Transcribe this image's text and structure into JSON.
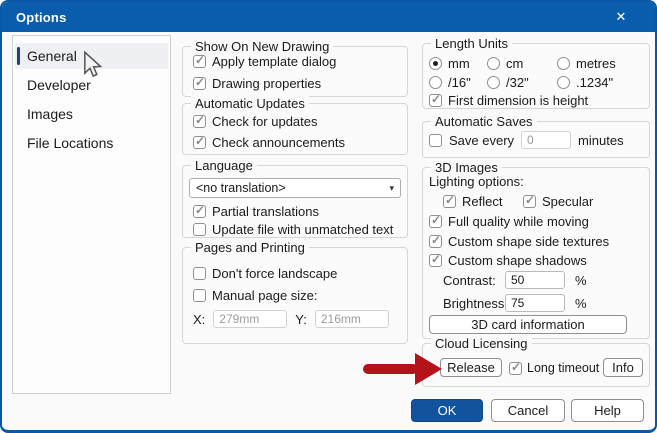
{
  "window": {
    "title": "Options",
    "close_icon": "✕"
  },
  "colors": {
    "titlebar": "#0a5dad",
    "ok_button": "#11549d",
    "annotation_arrow": "#b5121b",
    "sidebar_accent": "#17477f"
  },
  "sidebar": {
    "items": [
      {
        "label": "General",
        "selected": true
      },
      {
        "label": "Developer",
        "selected": false
      },
      {
        "label": "Images",
        "selected": false
      },
      {
        "label": "File Locations",
        "selected": false
      }
    ]
  },
  "mid": {
    "show": {
      "title": "Show On New Drawing",
      "items": [
        {
          "label": "Apply template dialog",
          "checked": true
        },
        {
          "label": "Drawing properties",
          "checked": true
        }
      ]
    },
    "updates": {
      "title": "Automatic Updates",
      "items": [
        {
          "label": "Check for updates",
          "checked": true
        },
        {
          "label": "Check announcements",
          "checked": true
        }
      ]
    },
    "language": {
      "title": "Language",
      "combo_value": "<no translation>",
      "combo_arrow": "▾",
      "items": [
        {
          "label": "Partial translations",
          "checked": true
        },
        {
          "label": "Update file with unmatched text",
          "checked": false
        }
      ]
    },
    "pages": {
      "title": "Pages and Printing",
      "items": [
        {
          "label": "Don't force landscape",
          "checked": false
        },
        {
          "label": "Manual page size:",
          "checked": false
        }
      ],
      "x_label": "X:",
      "x_value": "279mm",
      "y_label": "Y:",
      "y_value": "216mm"
    }
  },
  "right": {
    "length": {
      "title": "Length Units",
      "radios": [
        {
          "label": "mm",
          "selected": true
        },
        {
          "label": "cm",
          "selected": false
        },
        {
          "label": "metres",
          "selected": false
        },
        {
          "label": "/16\"",
          "selected": false
        },
        {
          "label": "/32\"",
          "selected": false
        },
        {
          "label": ".1234\"",
          "selected": false
        }
      ],
      "height_cb": {
        "label": "First dimension is height",
        "checked": true
      }
    },
    "saves": {
      "title": "Automatic Saves",
      "cb": {
        "label": "Save every",
        "checked": false
      },
      "value": "0",
      "suffix": "minutes"
    },
    "threed": {
      "title": "3D Images",
      "lighting_label": "Lighting options:",
      "reflect": {
        "label": "Reflect",
        "checked": true
      },
      "specular": {
        "label": "Specular",
        "checked": true
      },
      "full": {
        "label": "Full quality while moving",
        "checked": true
      },
      "side": {
        "label": "Custom shape side textures",
        "checked": true
      },
      "shadows": {
        "label": "Custom shape shadows",
        "checked": true
      },
      "contrast_label": "Contrast:",
      "contrast_value": "50",
      "brightness_label": "Brightness:",
      "brightness_value": "75",
      "percent": "%",
      "card_button": "3D card information"
    },
    "cloud": {
      "title": "Cloud Licensing",
      "release_button": "Release",
      "cb": {
        "label": "Long timeout",
        "checked": true
      },
      "info_button": "Info"
    }
  },
  "footer": {
    "ok": "OK",
    "cancel": "Cancel",
    "help": "Help"
  }
}
